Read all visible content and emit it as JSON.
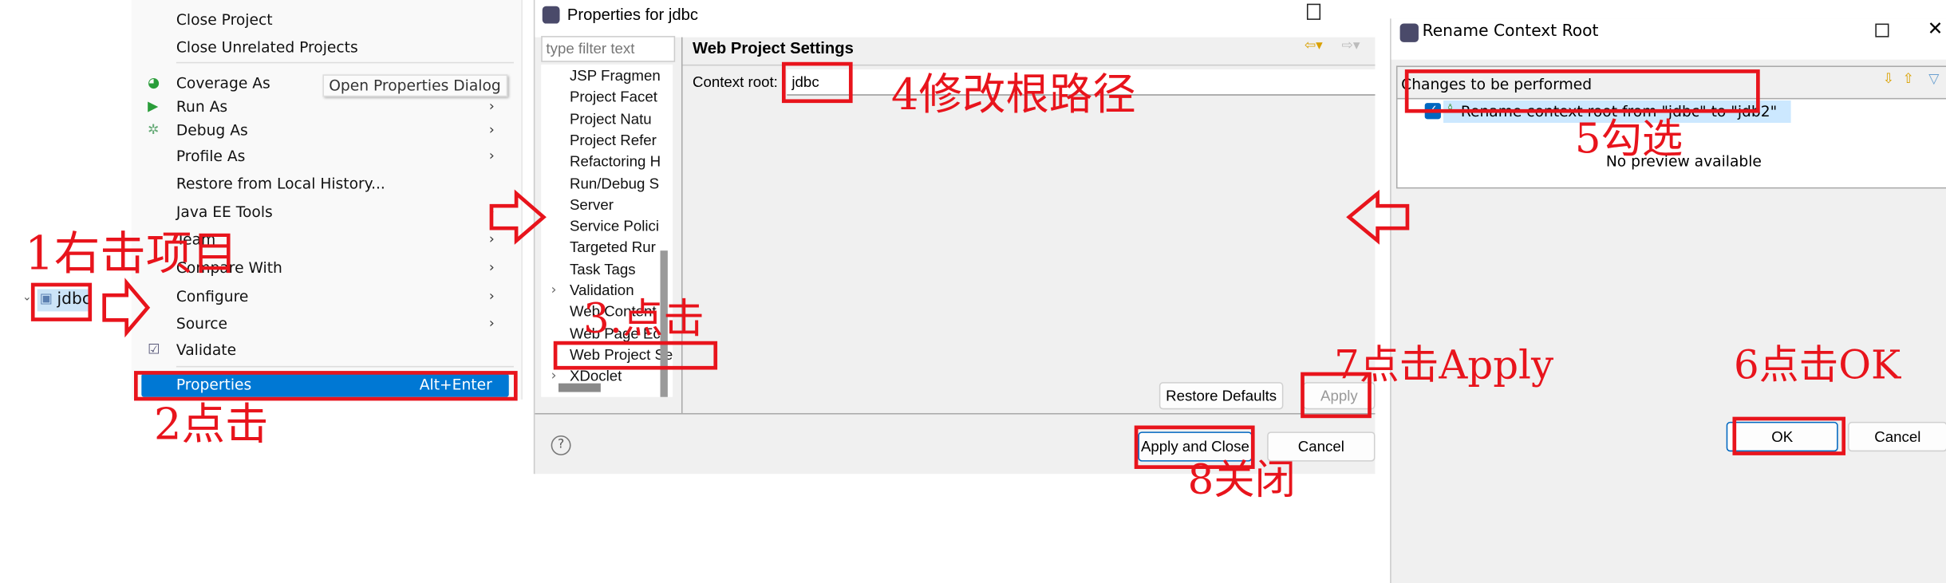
{
  "explorer": {
    "project": "jdbc"
  },
  "context_menu": {
    "items": [
      {
        "label": "Close Project"
      },
      {
        "label": "Close Unrelated Projects"
      },
      {
        "label": "Coverage As",
        "icon": "coverage-icon"
      },
      {
        "label": "Run As",
        "icon": "run-icon"
      },
      {
        "label": "Debug As",
        "icon": "debug-icon"
      },
      {
        "label": "Profile As"
      },
      {
        "label": "Restore from Local History..."
      },
      {
        "label": "Java EE Tools"
      },
      {
        "label": "Team"
      },
      {
        "label": "Compare With"
      },
      {
        "label": "Configure"
      },
      {
        "label": "Source"
      },
      {
        "label": "Validate",
        "icon": "checkbox-icon"
      }
    ],
    "properties": {
      "label": "Properties",
      "shortcut": "Alt+Enter"
    },
    "tooltip": "Open Properties Dialog",
    "highlight_color": "#0078d4"
  },
  "properties_dialog": {
    "title": "Properties for jdbc",
    "filter_placeholder": "type filter text",
    "tree": [
      "JSP Fragmen",
      "Project Facet",
      "Project Natu",
      "Project Refer",
      "Refactoring H",
      "Run/Debug S",
      "Server",
      "Service Polici",
      "Targeted Rur",
      "Task Tags",
      "Validation",
      "Web Content",
      "Web Page Ec",
      "Web Project Settings",
      "XDoclet"
    ],
    "page_title": "Web Project Settings",
    "context_root_label": "Context root:",
    "context_root_value": "jdbc",
    "restore_defaults": "Restore Defaults",
    "apply": "Apply",
    "apply_and_close": "Apply and Close",
    "cancel": "Cancel"
  },
  "rename_dialog": {
    "title": "Rename Context Root",
    "changes_header": "Changes to be performed",
    "change_item": "Rename context root from \"jdbc\" to \"jdb2\"",
    "change_checked": true,
    "no_preview": "No preview available",
    "ok": "OK",
    "cancel": "Cancel"
  },
  "annotations": {
    "step1": "1右击项目",
    "step2": "2点击",
    "step3": "3.点击",
    "step4": "4修改根路径",
    "step5": "5勾选",
    "step6": "6点击OK",
    "step7": "7点击Apply",
    "step8": "8关闭",
    "color": "#e8141c"
  }
}
